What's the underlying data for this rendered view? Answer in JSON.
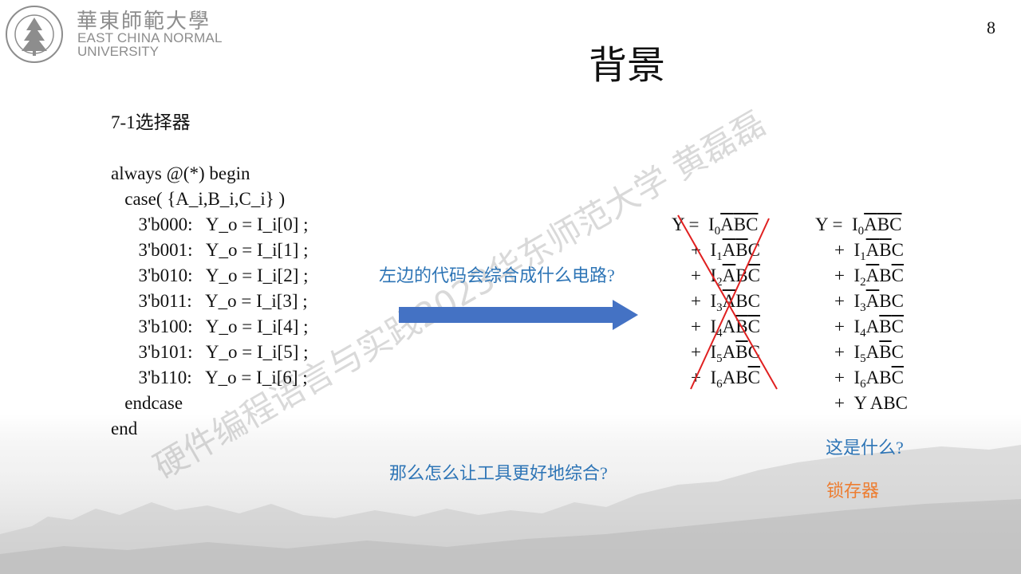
{
  "logo": {
    "cn": "華東師範大學",
    "en_line1": "EAST CHINA NORMAL",
    "en_line2": "UNIVERSITY"
  },
  "page_number": "8",
  "title": "背景",
  "code": {
    "heading": "7-1选择器",
    "lines": [
      "always @(*) begin",
      "   case( {A_i,B_i,C_i} )",
      "      3'b000:   Y_o = I_i[0] ;",
      "      3'b001:   Y_o = I_i[1] ;",
      "      3'b010:   Y_o = I_i[2] ;",
      "      3'b011:   Y_o = I_i[3] ;",
      "      3'b100:   Y_o = I_i[4] ;",
      "      3'b101:   Y_o = I_i[5] ;",
      "      3'b110:   Y_o = I_i[6] ;",
      "   endcase",
      "end"
    ]
  },
  "question": "左边的代码会综合成什么电路?",
  "bottom_question": "那么怎么让工具更好地综合?",
  "what_is": "这是什么?",
  "latch": "锁存器",
  "watermark": "硬件编程语言与实践2023华东师范大学 黄磊磊",
  "equations": {
    "y_label": "Y =",
    "plus": "+",
    "extra_term": "Y ABC",
    "colors": {
      "question": "#2e75b6",
      "latch": "#ed7d31",
      "cross": "#e02020",
      "arrow": "#4472c4"
    }
  }
}
